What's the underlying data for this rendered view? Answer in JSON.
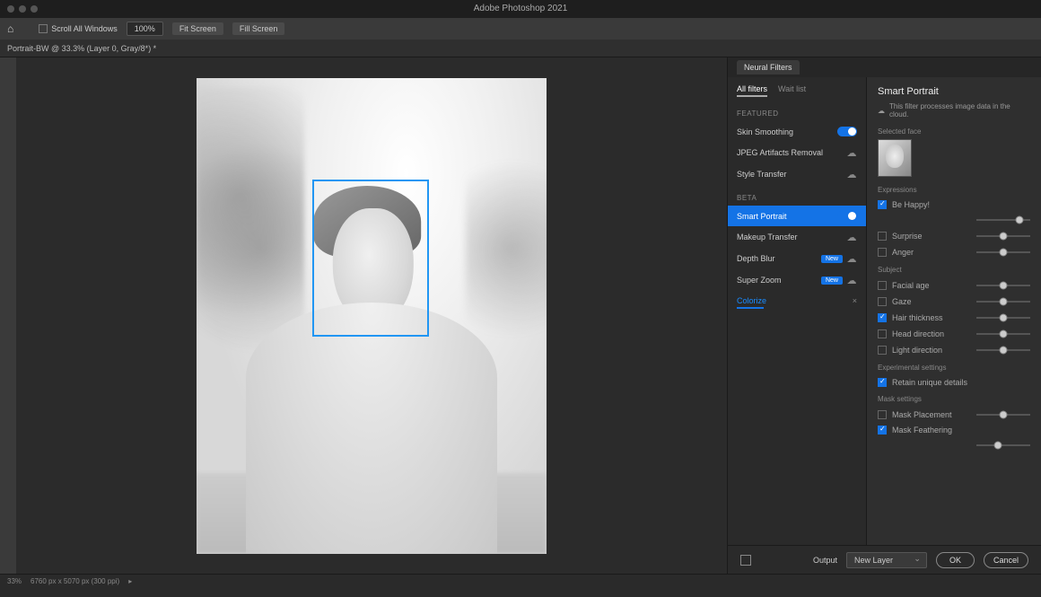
{
  "window": {
    "title": "Adobe Photoshop 2021"
  },
  "toolbar": {
    "scroll_all": "Scroll All Windows",
    "zoom": "100%",
    "fit_screen": "Fit Screen",
    "fill_screen": "Fill Screen"
  },
  "doc": {
    "tab": "Portrait-BW @ 33.3% (Layer 0, Gray/8*) *"
  },
  "panel": {
    "tab": "Neural Filters",
    "filters_tab_all": "All filters",
    "filters_tab_wait": "Wait list",
    "section_featured": "FEATURED",
    "section_beta": "BETA",
    "filters": {
      "skin_smoothing": "Skin Smoothing",
      "jpeg_artifacts": "JPEG Artifacts Removal",
      "style_transfer": "Style Transfer",
      "smart_portrait": "Smart Portrait",
      "makeup_transfer": "Makeup Transfer",
      "depth_blur": "Depth Blur",
      "super_zoom": "Super Zoom",
      "colorize": "Colorize"
    },
    "badge_new": "New"
  },
  "settings": {
    "title": "Smart Portrait",
    "cloud_note": "This filter processes image data in the cloud.",
    "selected_face": "Selected face",
    "expressions": "Expressions",
    "be_happy": "Be Happy!",
    "surprise": "Surprise",
    "anger": "Anger",
    "subject": "Subject",
    "facial_age": "Facial age",
    "gaze": "Gaze",
    "hair_thickness": "Hair thickness",
    "head_direction": "Head direction",
    "light_direction": "Light direction",
    "experimental": "Experimental settings",
    "retain_unique": "Retain unique details",
    "mask_settings": "Mask settings",
    "mask_placement": "Mask Placement",
    "mask_feathering": "Mask Feathering"
  },
  "footer": {
    "output_label": "Output",
    "output_value": "New Layer",
    "ok": "OK",
    "cancel": "Cancel"
  },
  "status": {
    "zoom": "33%",
    "info": "6760 px x 5070 px (300 ppi)"
  }
}
